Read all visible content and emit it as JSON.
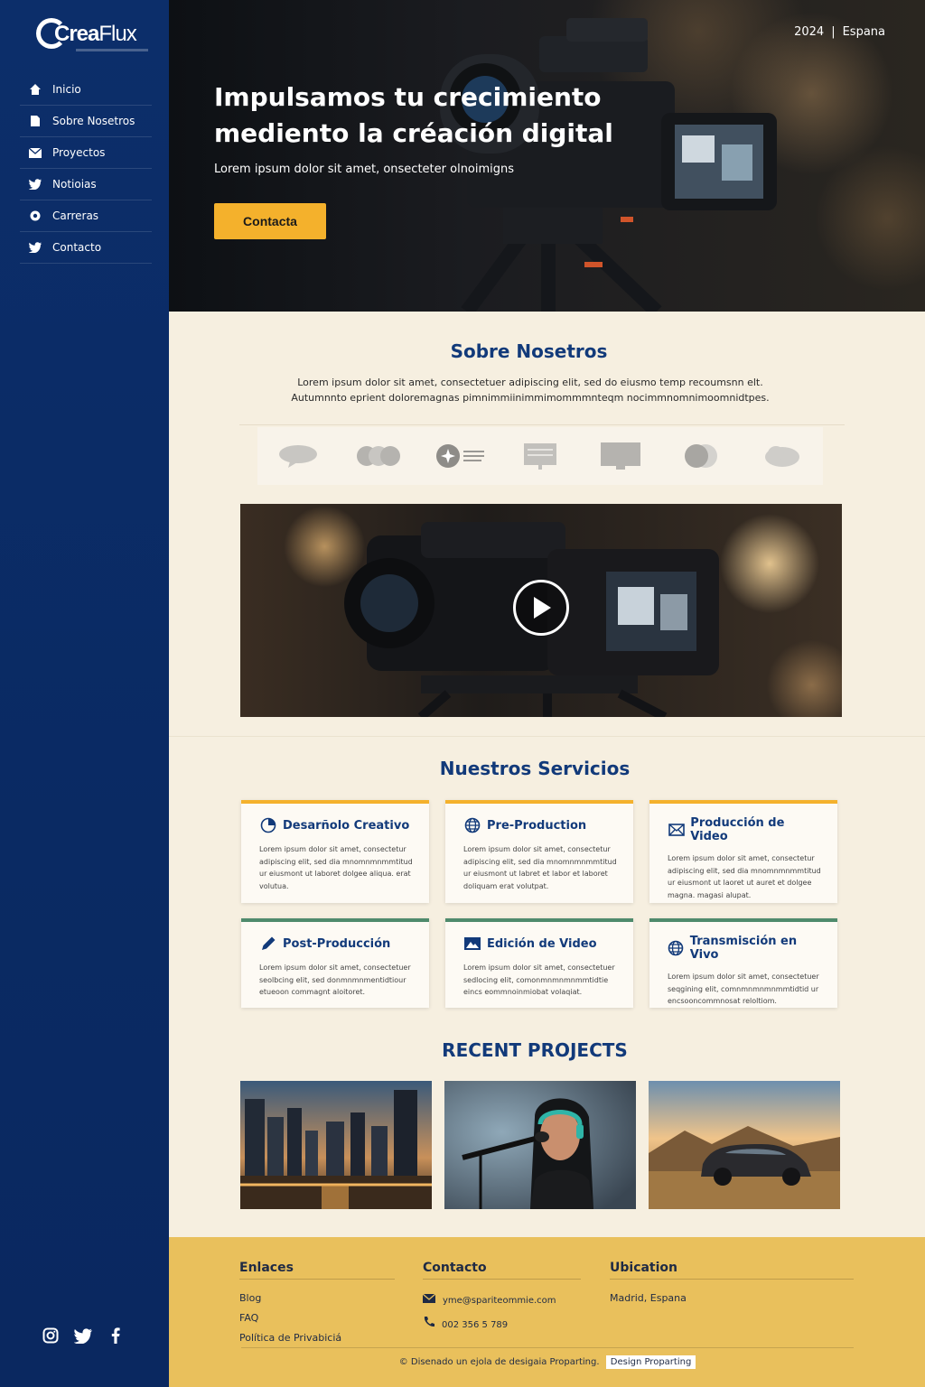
{
  "brand": {
    "name_bold": "Crea",
    "name_light": "Flux"
  },
  "sidebar": {
    "items": [
      {
        "label": "Inicio",
        "icon": "home-icon"
      },
      {
        "label": "Sobre Nosetros",
        "icon": "document-icon"
      },
      {
        "label": "Proyectos",
        "icon": "mail-icon"
      },
      {
        "label": "Notioias",
        "icon": "twitter-icon"
      },
      {
        "label": "Carreras",
        "icon": "gear-icon"
      },
      {
        "label": "Contacto",
        "icon": "twitter-icon"
      }
    ],
    "social": [
      "instagram-icon",
      "twitter-icon",
      "facebook-icon"
    ]
  },
  "hero": {
    "year": "2024",
    "separator": "|",
    "location": "Espana",
    "title": "Impulsamos tu crecimiento mediento la créación digital",
    "subtitle": "Lorem ipsum dolor sit amet, onsecteter olnoimigns",
    "cta_label": "Contacta"
  },
  "about": {
    "title": "Sobre Nosetros",
    "text_1": "Lorem ipsum dolor sit amet, consectetuer adipiscing elit, sed do eiusmo temp recoumsnn elt.",
    "text_2": "Autumnnto eprient doloremagnas pimnimmiinimmimommmnteqm nocimmnomnimoomnidtpes."
  },
  "services": {
    "title": "Nuestros Servicios",
    "cards": [
      {
        "title": "Desarñolo Creativo",
        "icon": "chart-icon",
        "text": "Lorem ipsum dolor sit amet, consectetur adipiscing elit, sed dia mnomnmnmmtitud ur eiusmont ut laboret dolgee aliqua. erat volutua."
      },
      {
        "title": "Pre-Production",
        "icon": "globe-icon",
        "text": "Lorem ipsum dolor sit amet, consectetur adipiscing elit, sed dia mnomnmnmmtitud ur eiusmont ut labret et labor et laboret doliquam erat volutpat."
      },
      {
        "title": "Producción de Video",
        "icon": "mail-icon",
        "text": "Lorem ipsum dolor sit amet, consectetur adipiscing elit, sed dia mnomnmnmmtitud ur eiusmont ut laoret ut auret et dolgee magna. magasi alupat."
      },
      {
        "title": "Post-Producción",
        "icon": "pencil-icon",
        "text": "Lorem ipsum dolor sit amet, consectetuer seolbcing elit, sed donmnmnmentidtiour etueoon commagnt aloitoret."
      },
      {
        "title": "Edición de Video",
        "icon": "image-icon",
        "text": "Lorem ipsum dolor sit amet, consectetuer sedlocing elit, comonmnmnmnmmtidtie eincs eommnoinmiobat volaqiat."
      },
      {
        "title": "Transmisción en Vivo",
        "icon": "globe-icon",
        "text": "Lorem ipsum dolor sit amet, consectetuer seqgining elit, comnmnmnmnmmtidtid ur encsooncommnosat reloltiom."
      }
    ]
  },
  "projects": {
    "title": "RECENT PROJECTS",
    "items": [
      "city-skyline",
      "singer-microphone",
      "car-desert"
    ]
  },
  "footer": {
    "links_title": "Enlaces",
    "links": [
      "Blog",
      "FAQ",
      "Política de Privabiciá"
    ],
    "contact_title": "Contacto",
    "email": "yme@spariteommie.com",
    "phone": "002 356 5 789",
    "location_title": "Ubication",
    "location": "Madrid, Espana",
    "copyright": "© Disenado un ejola de desigaia Proparting.",
    "badge": "Design Proparting"
  },
  "colors": {
    "sidebar": "#0c2e6a",
    "accent": "#f4b12c",
    "heading": "#123a7a",
    "footer": "#e9c05c",
    "card_green": "#4f8a6c"
  }
}
